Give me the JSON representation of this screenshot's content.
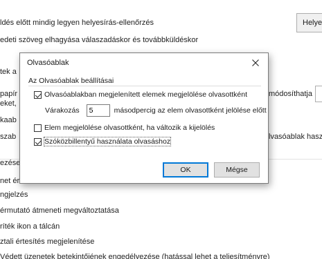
{
  "background": {
    "lines": [
      "ldés előtt mindig legyen helyesírás-ellenőrzés",
      "edeti szöveg elhagyása válaszadáskor és továbbküldéskor",
      "tek a",
      "papír",
      "eket,",
      "kaab",
      "szab",
      "ezése",
      "net érkezésekor:",
      "ngjelzés",
      "érmutató átmeneti megváltoztatása",
      "ríték ikon a tálcán",
      "ztali értesítés megjelenítése",
      "Védett üzenetek betekintőjének engedélyezése (hatással lehet a teljesítményre)"
    ],
    "right_fragments": {
      "modosithatja": "módosíthatja",
      "olvasoablak": "lvasóablak haszn"
    },
    "right_button_label": "Helyes"
  },
  "dialog": {
    "title": "Olvasóablak",
    "group_title": "Az Olvasóablak beállításai",
    "options": [
      {
        "label": "Olvasóablakban megjelenített elemek megjelölése olvasottként",
        "checked": true
      },
      {
        "label": "Elem megjelölése olvasottként, ha változik a kijelölés",
        "checked": false
      },
      {
        "label": "Szóközbillentyű használata olvasáshoz",
        "checked": true
      }
    ],
    "delay": {
      "prefix": "Várakozás",
      "value": "5",
      "suffix": "másodpercig az elem olvasottként jelölése előtt"
    },
    "ok_label": "OK",
    "cancel_label": "Mégse"
  }
}
